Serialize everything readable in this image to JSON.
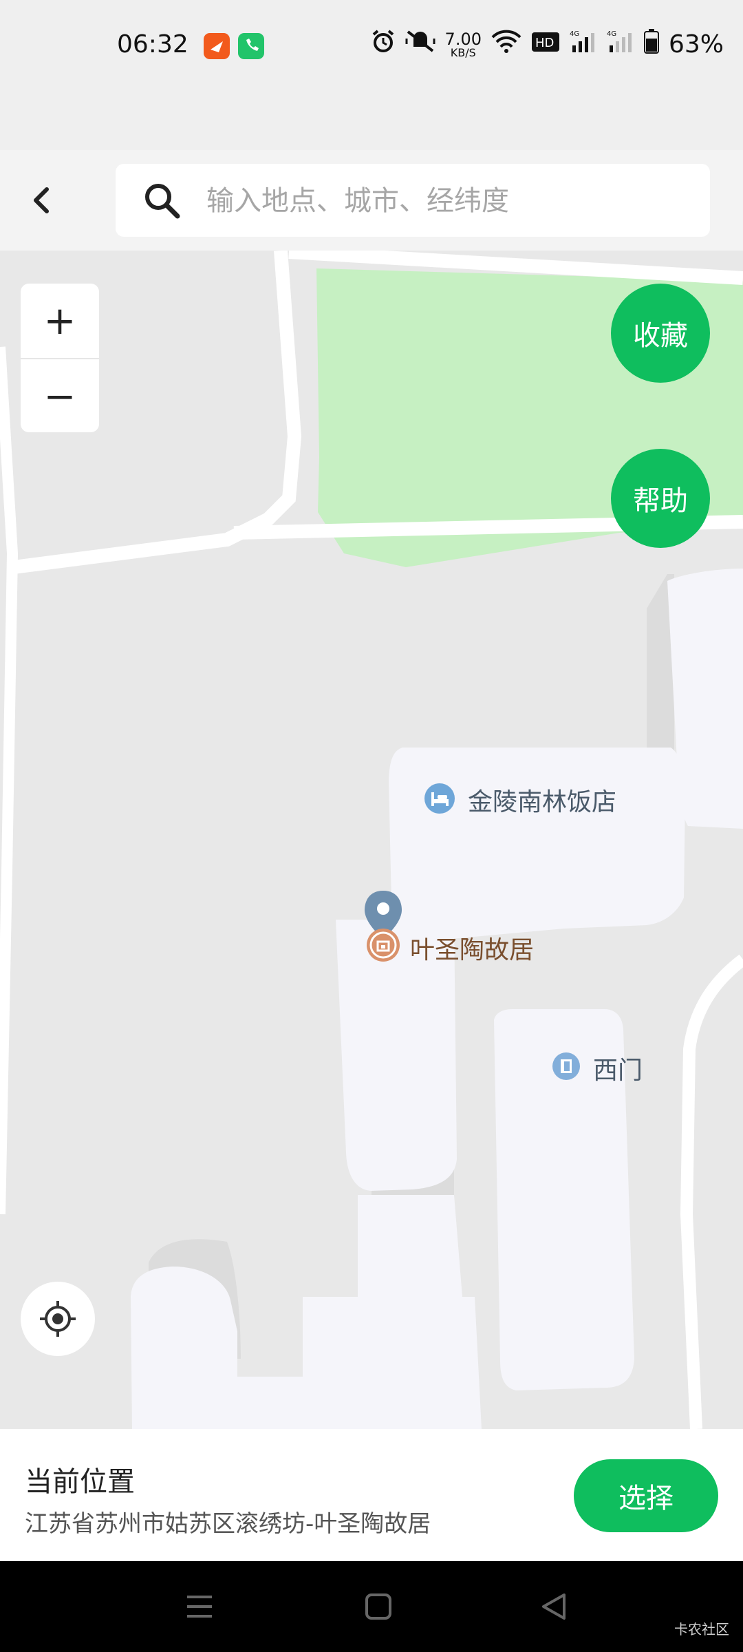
{
  "status_bar": {
    "time": "06:32",
    "net_speed_value": "7.00",
    "net_speed_unit": "KB/S",
    "battery_percent": "63%",
    "icons": [
      "feishu-app-icon",
      "phone-app-icon",
      "alarm-icon",
      "mute-icon",
      "wifi-icon",
      "hd-icon",
      "signal-4g-icon",
      "signal-4g-icon",
      "battery-icon"
    ]
  },
  "header": {
    "search_placeholder": "输入地点、城市、经纬度"
  },
  "map": {
    "zoom_in": "+",
    "zoom_out": "−",
    "favorite_button": "收藏",
    "help_button": "帮助",
    "pois": [
      {
        "name": "金陵南林饭店",
        "icon": "hotel-icon"
      },
      {
        "name": "叶圣陶故居",
        "icon": "scenic-spot-icon"
      },
      {
        "name": "西门",
        "icon": "gate-icon"
      }
    ]
  },
  "location_card": {
    "title": "当前位置",
    "address": "江苏省苏州市姑苏区滚绣坊-叶圣陶故居",
    "select_button": "选择"
  },
  "watermark": "卡农社区",
  "colors": {
    "accent": "#0fbe5e",
    "park": "#c6f0c2",
    "building": "#f5f5fa",
    "road": "#ffffff",
    "poi_text_brown": "#7a4f2e",
    "poi_text_slate": "#4a5a6a"
  }
}
